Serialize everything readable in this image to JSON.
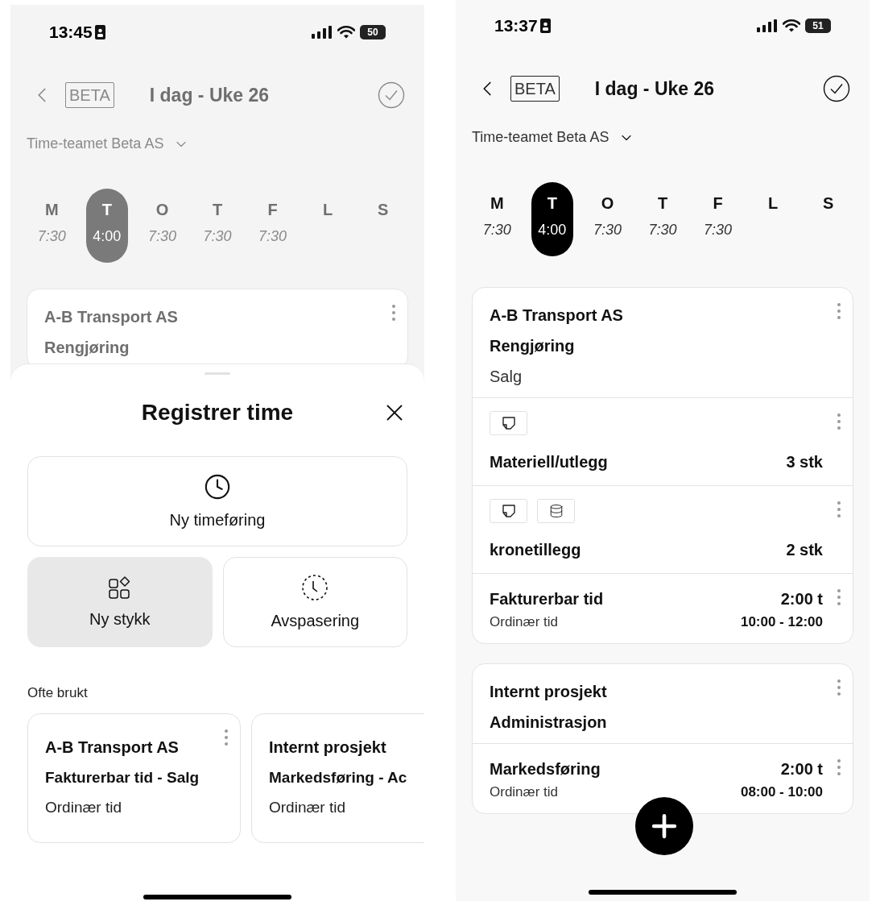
{
  "screens": [
    {
      "dimmed": true,
      "status_bar": {
        "time": "13:45",
        "battery": "50"
      },
      "header": {
        "badge": "BETA",
        "title": "I dag - Uke 26"
      },
      "company": "Time-teamet Beta AS",
      "days": [
        {
          "letter": "M",
          "hours": "7:30",
          "selected": false
        },
        {
          "letter": "T",
          "hours": "4:00",
          "selected": true
        },
        {
          "letter": "O",
          "hours": "7:30",
          "selected": false
        },
        {
          "letter": "T",
          "hours": "7:30",
          "selected": false
        },
        {
          "letter": "F",
          "hours": "7:30",
          "selected": false
        },
        {
          "letter": "L",
          "selected": false
        },
        {
          "letter": "S",
          "selected": false
        }
      ],
      "cards": [
        {
          "sections": [
            {
              "kind": "header",
              "lines": [
                "A-B Transport AS",
                "Rengjøring"
              ]
            }
          ]
        }
      ],
      "sheet": {
        "title": "Registrer time",
        "actions": [
          {
            "kind": "clock",
            "label": "Ny timeføring",
            "selected": false
          },
          {
            "kind": "pieces",
            "label": "Ny stykk",
            "selected": true
          },
          {
            "kind": "dashed-clock",
            "label": "Avspasering",
            "selected": false
          }
        ],
        "recent_label": "Ofte brukt",
        "recent": [
          {
            "title": "A-B Transport AS",
            "activity": "Fakturerbar tid - Salg",
            "type": "Ordinær tid"
          },
          {
            "title": "Internt prosjekt",
            "activity": "Markedsføring - Ac",
            "type": "Ordinær tid"
          }
        ]
      }
    },
    {
      "dimmed": false,
      "status_bar": {
        "time": "13:37",
        "battery": "51"
      },
      "header": {
        "badge": "BETA",
        "title": "I dag - Uke 26"
      },
      "company": "Time-teamet Beta AS",
      "days": [
        {
          "letter": "M",
          "hours": "7:30",
          "selected": false
        },
        {
          "letter": "T",
          "hours": "4:00",
          "selected": true
        },
        {
          "letter": "O",
          "hours": "7:30",
          "selected": false
        },
        {
          "letter": "T",
          "hours": "7:30",
          "selected": false
        },
        {
          "letter": "F",
          "hours": "7:30",
          "selected": false
        },
        {
          "letter": "L",
          "selected": false
        },
        {
          "letter": "S",
          "selected": false
        }
      ],
      "cards": [
        {
          "sections": [
            {
              "kind": "header",
              "lines": [
                "A-B Transport AS",
                "Rengjøring",
                "Salg"
              ]
            },
            {
              "kind": "item",
              "attachments": [
                {
                  "kind": "note"
                }
              ],
              "title": "Materiell/utlegg",
              "amount": "3 stk"
            },
            {
              "kind": "item",
              "attachments": [
                {
                  "kind": "note"
                },
                {
                  "kind": "stack"
                }
              ],
              "title": "kronetillegg",
              "amount": "2 stk"
            },
            {
              "kind": "time",
              "title": "Fakturerbar tid",
              "amount": "2:00 t",
              "subtitle": "Ordinær tid",
              "range": "10:00 - 12:00"
            }
          ]
        },
        {
          "sections": [
            {
              "kind": "header",
              "lines": [
                "Internt prosjekt",
                "Administrasjon"
              ]
            },
            {
              "kind": "time",
              "title": "Markedsføring",
              "amount": "2:00 t",
              "subtitle": "Ordinær tid",
              "range": "08:00 - 10:00"
            }
          ]
        }
      ],
      "fab": true
    }
  ]
}
